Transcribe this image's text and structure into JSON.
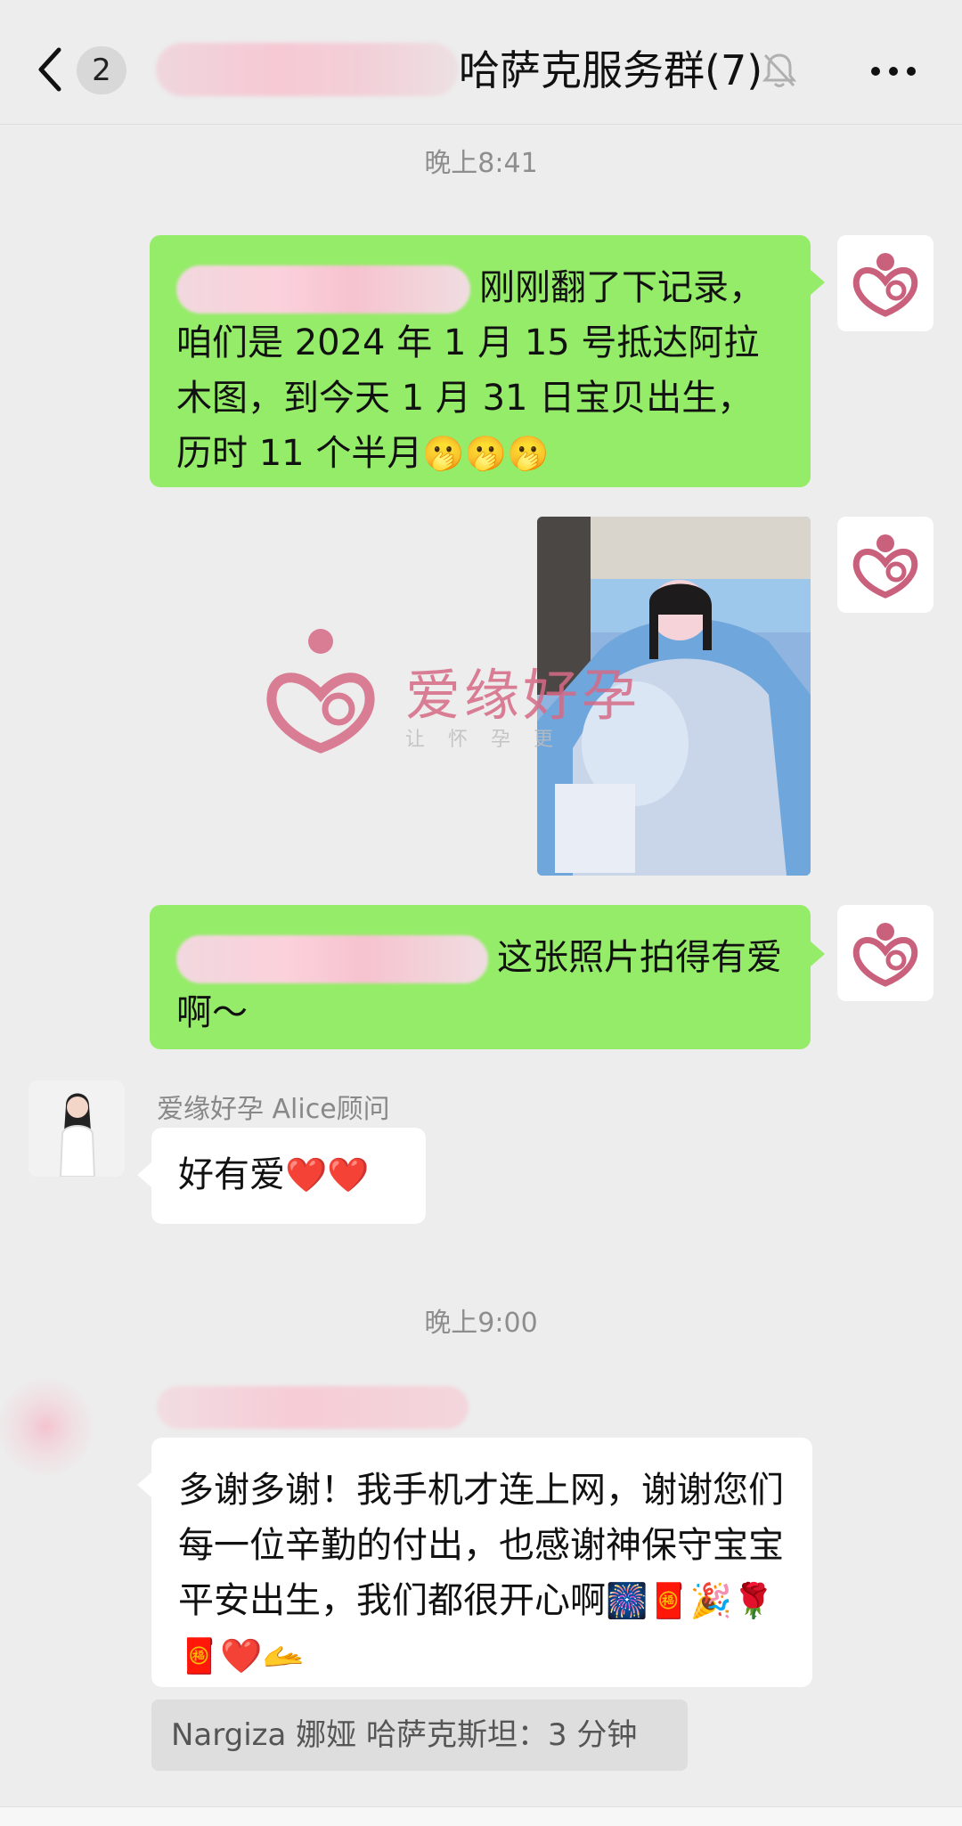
{
  "header": {
    "unread_count": "2",
    "title": "哈萨克服务群(7)"
  },
  "timestamps": [
    "晚上8:41",
    "晚上9:00"
  ],
  "messages": {
    "m1": {
      "text": "刚刚翻了下记录，咱们是 2024 年 1 月 15 号抵达阿拉木图，到今天 1 月 31 日宝贝出生，历时 11 个半月",
      "emoji": "🫢🫢🫢"
    },
    "m3": {
      "text": "这张照片拍得有爱啊～"
    },
    "m4": {
      "sender": "爱缘好孕 Alice顾问",
      "text": "好有爱",
      "emoji": "❤️❤️"
    },
    "m5": {
      "text": "多谢多谢！我手机才连上网，谢谢您们每一位辛勤的付出，也感谢神保守宝宝平安出生，我们都很开心啊",
      "emoji": "🎆🧧🎉🌹🧧❤️🫴",
      "quote": "Nargiza 娜娅 哈萨克斯坦：3 分钟"
    }
  },
  "watermark": {
    "brand": "爱缘好孕",
    "slogan": "让怀孕更"
  },
  "colors": {
    "bubble_green": "#95ec69",
    "bubble_white": "#ffffff",
    "background": "#ededed",
    "brand_pink": "#d66a86"
  },
  "icons": {
    "back": "chevron-left-icon",
    "mute": "bell-off-icon",
    "more": "more-dots-icon",
    "brand_avatar": "brand-logo-icon"
  }
}
